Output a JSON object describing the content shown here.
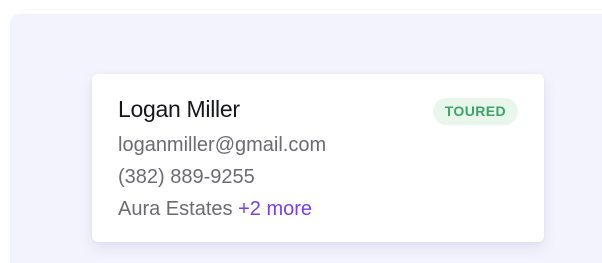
{
  "contact": {
    "name": "Logan Miller",
    "status": "TOURED",
    "email": "loganmiller@gmail.com",
    "phone": "(382) 889-9255",
    "property": "Aura Estates",
    "more_link": "+2 more"
  },
  "colors": {
    "page_bg": "#f3f3fd",
    "card_bg": "#ffffff",
    "name_text": "#16161d",
    "secondary_text": "#6b6b73",
    "badge_bg": "#e8f6ec",
    "badge_text": "#3ba664",
    "link": "#7b3fe4"
  }
}
